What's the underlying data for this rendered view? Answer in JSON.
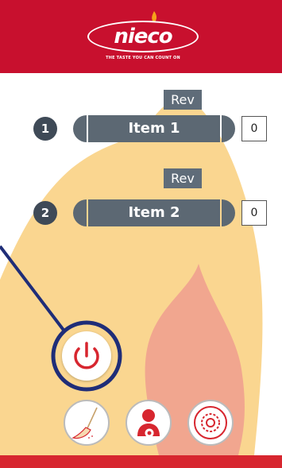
{
  "header": {
    "logo_text": "nieco",
    "tagline": "THE TASTE YOU CAN COUNT ON"
  },
  "items": [
    {
      "number": "1",
      "rev_label": "Rev",
      "name": "Item 1",
      "count": "0"
    },
    {
      "number": "2",
      "rev_label": "Rev",
      "name": "Item 2",
      "count": "0"
    }
  ],
  "controls": {
    "power_icon": "power-icon",
    "clean_icon": "broom-icon",
    "user_settings_icon": "user-gear-icon",
    "settings_icon": "gear-icon"
  },
  "colors": {
    "brand_red": "#c8102e",
    "item_gray": "#5c6873",
    "rev_gray": "#5f6c79",
    "number_gray": "#3f4a57",
    "highlight_navy": "#1f2d78",
    "flame_outer": "#f9cf7c",
    "flame_inner": "#ef9e8f"
  }
}
